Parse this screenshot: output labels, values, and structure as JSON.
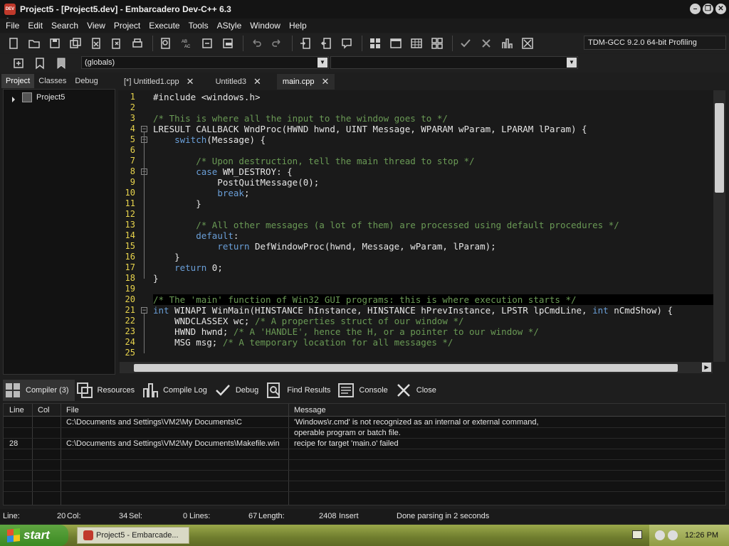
{
  "window": {
    "title": "Project5 - [Project5.dev] - Embarcadero Dev-C++ 6.3",
    "icon_label": "DEV C++"
  },
  "menu": [
    "File",
    "Edit",
    "Search",
    "View",
    "Project",
    "Execute",
    "Tools",
    "AStyle",
    "Window",
    "Help"
  ],
  "toolbar": {
    "icons": [
      "new-file-icon",
      "open-icon",
      "save-icon",
      "save-all-icon",
      "close-file-icon",
      "close-all-icon",
      "print-icon",
      "find-icon",
      "replace-icon",
      "goto-icon",
      "toggle-bookmark-icon",
      "undo-icon",
      "redo-icon",
      "indent-icon",
      "unindent-icon",
      "comment-icon",
      "layout-icon",
      "fullscreen-icon",
      "grid-icon",
      "tiles-icon",
      "check-icon",
      "cross-icon",
      "chart-icon",
      "stop-icon"
    ],
    "compiler": "TDM-GCC 9.2.0 64-bit Profiling",
    "globals_combo": "(globals)",
    "function_combo": ""
  },
  "left_panel": {
    "tabs": [
      "Project",
      "Classes",
      "Debug"
    ],
    "active_tab": "Project",
    "tree_root": "Project5"
  },
  "editor": {
    "tabs": [
      {
        "label": "[*] Untitled1.cpp",
        "active": false
      },
      {
        "label": "Untitled3",
        "active": false
      },
      {
        "label": "main.cpp",
        "active": true
      }
    ],
    "current_line": 20,
    "lines": [
      {
        "n": "1",
        "segs": [
          [
            "",
            "#include <windows.h>"
          ]
        ]
      },
      {
        "n": "2",
        "segs": []
      },
      {
        "n": "3",
        "segs": [
          [
            "cmt",
            "/* This is where all the input to the window goes to */"
          ]
        ]
      },
      {
        "n": "4",
        "segs": [
          [
            "",
            "LRESULT CALLBACK WndProc(HWND hwnd, UINT Message, WPARAM wParam, LPARAM lParam) {"
          ]
        ],
        "fold": true
      },
      {
        "n": "5",
        "segs": [
          [
            "",
            "    "
          ],
          [
            "kw",
            "switch"
          ],
          [
            "",
            "(Message) {"
          ]
        ],
        "fold": true
      },
      {
        "n": "6",
        "segs": []
      },
      {
        "n": "7",
        "segs": [
          [
            "",
            "        "
          ],
          [
            "cmt",
            "/* Upon destruction, tell the main thread to stop */"
          ]
        ]
      },
      {
        "n": "8",
        "segs": [
          [
            "",
            "        "
          ],
          [
            "kw",
            "case"
          ],
          [
            "",
            " WM_DESTROY: {"
          ]
        ],
        "fold": true
      },
      {
        "n": "9",
        "segs": [
          [
            "",
            "            PostQuitMessage(0);"
          ]
        ]
      },
      {
        "n": "10",
        "segs": [
          [
            "",
            "            "
          ],
          [
            "kw",
            "break"
          ],
          [
            "",
            ";"
          ]
        ]
      },
      {
        "n": "11",
        "segs": [
          [
            "",
            "        }"
          ]
        ]
      },
      {
        "n": "12",
        "segs": []
      },
      {
        "n": "13",
        "segs": [
          [
            "",
            "        "
          ],
          [
            "cmt",
            "/* All other messages (a lot of them) are processed using default procedures */"
          ]
        ]
      },
      {
        "n": "14",
        "segs": [
          [
            "",
            "        "
          ],
          [
            "kw",
            "default"
          ],
          [
            "",
            ":"
          ]
        ]
      },
      {
        "n": "15",
        "segs": [
          [
            "",
            "            "
          ],
          [
            "kw",
            "return"
          ],
          [
            "",
            " DefWindowProc(hwnd, Message, wParam, lParam);"
          ]
        ]
      },
      {
        "n": "16",
        "segs": [
          [
            "",
            "    }"
          ]
        ]
      },
      {
        "n": "17",
        "segs": [
          [
            "",
            "    "
          ],
          [
            "kw",
            "return"
          ],
          [
            "",
            " 0;"
          ]
        ]
      },
      {
        "n": "18",
        "segs": [
          [
            "",
            "}"
          ]
        ]
      },
      {
        "n": "19",
        "segs": []
      },
      {
        "n": "20",
        "segs": [
          [
            "cmt",
            "/* The 'main' function of Win32 GUI programs: this is where execution starts */"
          ]
        ]
      },
      {
        "n": "21",
        "segs": [
          [
            "kw",
            "int"
          ],
          [
            "",
            " WINAPI WinMain(HINSTANCE hInstance, HINSTANCE hPrevInstance, LPSTR lpCmdLine, "
          ],
          [
            "kw",
            "int"
          ],
          [
            "",
            " nCmdShow) {"
          ]
        ],
        "fold": true
      },
      {
        "n": "22",
        "segs": [
          [
            "",
            "    WNDCLASSEX wc; "
          ],
          [
            "cmt",
            "/* A properties struct of our window */"
          ]
        ]
      },
      {
        "n": "23",
        "segs": [
          [
            "",
            "    HWND hwnd; "
          ],
          [
            "cmt",
            "/* A 'HANDLE', hence the H, or a pointer to our window */"
          ]
        ]
      },
      {
        "n": "24",
        "segs": [
          [
            "",
            "    MSG msg; "
          ],
          [
            "cmt",
            "/* A temporary location for all messages */"
          ]
        ]
      },
      {
        "n": "25",
        "segs": []
      }
    ]
  },
  "bottom_panel": {
    "tabs": [
      {
        "label": "Compiler (3)",
        "icon": "grid-icon",
        "active": true
      },
      {
        "label": "Resources",
        "icon": "resources-icon",
        "active": false
      },
      {
        "label": "Compile Log",
        "icon": "chart-icon",
        "active": false
      },
      {
        "label": "Debug",
        "icon": "check-icon",
        "active": false
      },
      {
        "label": "Find Results",
        "icon": "find-icon",
        "active": false
      },
      {
        "label": "Console",
        "icon": "console-icon",
        "active": false
      },
      {
        "label": "Close",
        "icon": "close-icon",
        "active": false
      }
    ],
    "columns": [
      "Line",
      "Col",
      "File",
      "Message"
    ],
    "rows": [
      {
        "line": "",
        "col": "",
        "file": "C:\\Documents and Settings\\VM2\\My Documents\\C",
        "message": "'Windows\\r.cmd' is not recognized as an internal or external command,"
      },
      {
        "line": "",
        "col": "",
        "file": "",
        "message": "operable program or batch file."
      },
      {
        "line": "28",
        "col": "",
        "file": "C:\\Documents and Settings\\VM2\\My Documents\\Makefile.win",
        "message": "recipe for target 'main.o' failed"
      }
    ]
  },
  "status": {
    "line_label": "Line:",
    "line_value": "20",
    "col_label": "Col:",
    "col_value": "34",
    "sel_label": "Sel:",
    "sel_value": "0",
    "lines_label": "Lines:",
    "lines_value": "67",
    "length_label": "Length:",
    "length_value": "2408",
    "mode": "Insert",
    "message": "Done parsing in 2 seconds"
  },
  "taskbar": {
    "start_label": "start",
    "task_label": "Project5 - Embarcade...",
    "clock": "12:26 PM"
  }
}
